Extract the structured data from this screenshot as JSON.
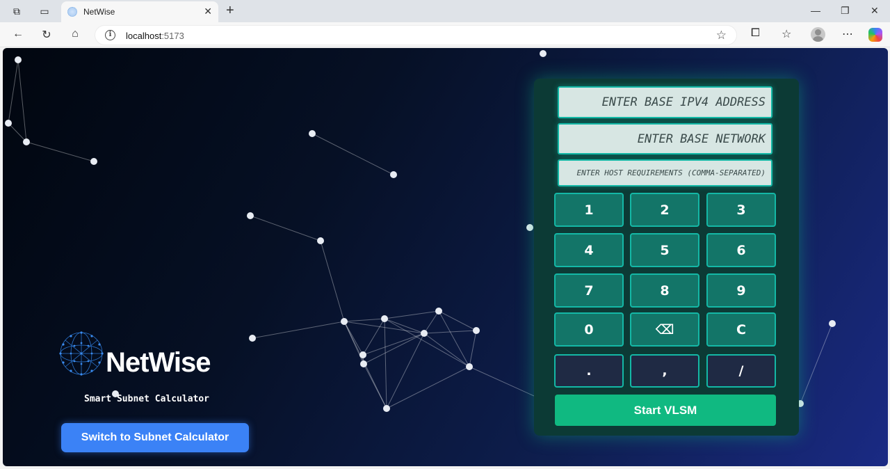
{
  "browser": {
    "tab_title": "NetWise",
    "url_host": "localhost",
    "url_port": ":5173"
  },
  "app": {
    "brand_name": "NetWise",
    "tagline": "Smart Subnet Calculator",
    "switch_button": "Switch to Subnet Calculator"
  },
  "calculator": {
    "ip_placeholder": "Enter Base IPv4 Address",
    "network_placeholder": "Enter Base Network",
    "hosts_placeholder": "Enter host requirements (comma-separated)",
    "keys": {
      "k1": "1",
      "k2": "2",
      "k3": "3",
      "k4": "4",
      "k5": "5",
      "k6": "6",
      "k7": "7",
      "k8": "8",
      "k9": "9",
      "k0": "0",
      "backspace": "⌫",
      "clear": "C",
      "dot": ".",
      "comma": ",",
      "slash": "/"
    },
    "start_button": "Start VLSM"
  },
  "colors": {
    "accent_teal": "#14b8a6",
    "key_teal": "#137568",
    "start_green": "#10b981",
    "switch_blue": "#3b82f6"
  },
  "icons": [
    "workspaces-icon",
    "tab-actions-icon",
    "close-icon",
    "new-tab-icon",
    "minimize-icon",
    "restore-icon",
    "window-close-icon",
    "back-icon",
    "refresh-icon",
    "home-icon",
    "info-icon",
    "favorite-star-icon",
    "extensions-icon",
    "favorites-icon",
    "profile-icon",
    "more-icon",
    "copilot-icon",
    "globe-icon"
  ]
}
